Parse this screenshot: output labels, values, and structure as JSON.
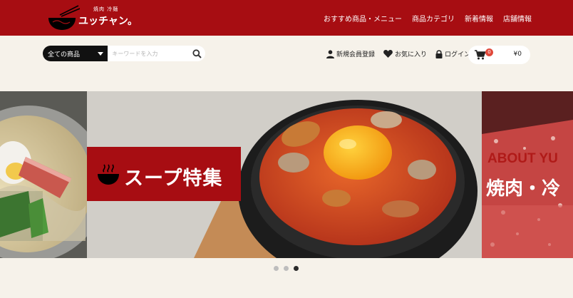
{
  "brand": {
    "small": "焼肉 冷麺",
    "name": "ユッチャン。"
  },
  "nav": [
    {
      "label": "おすすめ商品・メニュー"
    },
    {
      "label": "商品カテゴリ"
    },
    {
      "label": "新着情報"
    },
    {
      "label": "店舗情報"
    }
  ],
  "search": {
    "category": "全ての商品",
    "placeholder": "キーワードを入力",
    "value": ""
  },
  "user_links": {
    "register": "新規会員登録",
    "favorites": "お気に入り",
    "login": "ログイン"
  },
  "cart": {
    "count": "0",
    "total": "¥0"
  },
  "slider": {
    "main_label": "スープ特集",
    "right_title": "ABOUT YU",
    "right_sub": "焼肉・冷",
    "slide_count": 3,
    "active_slide": 3
  },
  "colors": {
    "brand_red": "#a70d12",
    "page_bg": "#f6f2ea",
    "badge": "#e0483a"
  }
}
